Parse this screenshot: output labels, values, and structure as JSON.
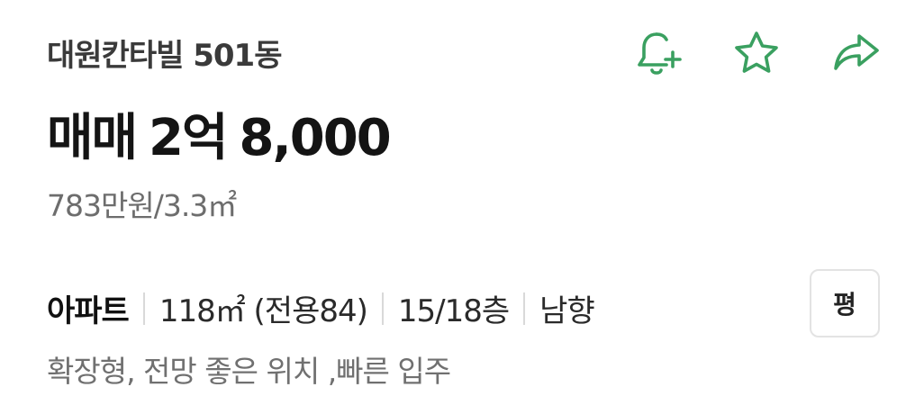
{
  "listing": {
    "complex_name": "대원칸타빌 501동",
    "price_type": "매매",
    "price_eok": "2억",
    "price_rest": "8,000",
    "unit_price": "783만원/3.3㎡",
    "property_type": "아파트",
    "area": "118㎡ (전용84)",
    "floor": "15/18층",
    "direction": "남향",
    "description": "확장형, 전망 좋은 위치 ,빠른 입주"
  },
  "actions": {
    "alert_icon": "bell-plus-icon",
    "favorite_icon": "star-icon",
    "share_icon": "share-arrow-icon",
    "icon_color": "#3aa060"
  },
  "unit_toggle": {
    "label": "평"
  }
}
